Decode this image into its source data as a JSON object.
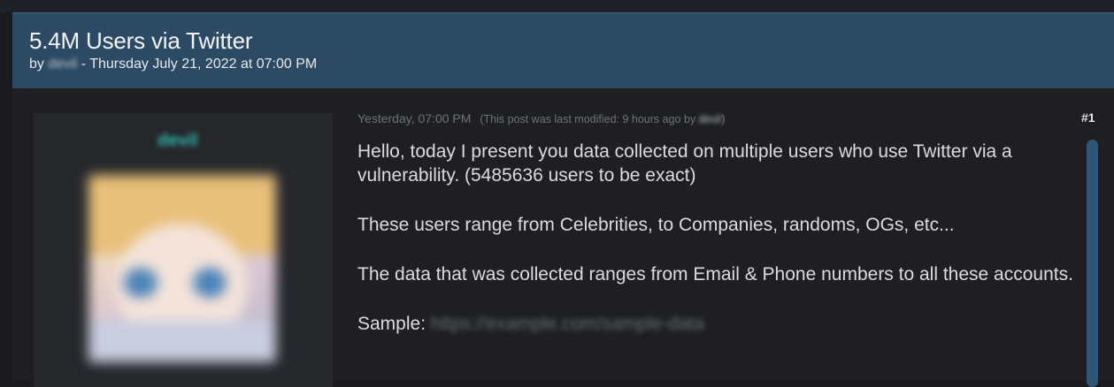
{
  "thread": {
    "title": "5.4M Users via Twitter",
    "by_prefix": "by",
    "author": "devil",
    "date": "- Thursday July 21, 2022 at 07:00 PM"
  },
  "post": {
    "username": "devil",
    "timestamp": "Yesterday, 07:00 PM",
    "modified_note_prefix": "(This post was last modified: 9 hours ago by",
    "modified_by": "devil",
    "modified_note_suffix": ")",
    "number": "#1",
    "paragraphs": [
      "Hello, today I present you data collected on multiple users who use Twitter via a vulnerability. (5485636 users to be exact)",
      "These users range from Celebrities, to Companies, randoms, OGs, etc...",
      "The data that was collected ranges from Email & Phone numbers to all these accounts."
    ],
    "sample_label": "Sample:",
    "sample_link": "https://example.com/sample-data"
  },
  "icons": {
    "avatar": "user-avatar-image"
  },
  "colors": {
    "header": "#2c4a63",
    "username": "#2fb6b0",
    "background": "#1b1b1f"
  }
}
